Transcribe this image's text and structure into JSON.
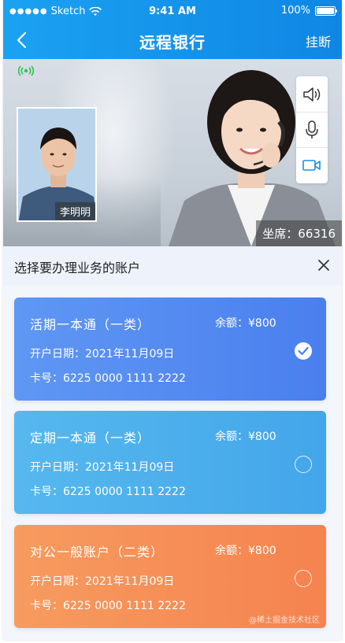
{
  "status_bar": {
    "carrier": "Sketch",
    "time": "9:41 AM",
    "battery": "100%"
  },
  "nav": {
    "title": "远程银行",
    "hangup_label": "挂断"
  },
  "video": {
    "caller_name": "李明明",
    "seat_label": "坐席：66316"
  },
  "account_panel": {
    "title": "选择要办理业务的账户"
  },
  "accounts": [
    {
      "name": "活期一本通（一类）",
      "balance": "余额：¥800",
      "open_date": "开户日期：2021年11月09日",
      "card_no": "卡号：6225 0000 1111 2222",
      "selected": true
    },
    {
      "name": "定期一本通（一类）",
      "balance": "余额：¥800",
      "open_date": "开户日期：2021年11月09日",
      "card_no": "卡号：6225 0000 1111 2222",
      "selected": false
    },
    {
      "name": "对公一般账户（二类）",
      "balance": "余额：¥800",
      "open_date": "开户日期：2021年11月09日",
      "card_no": "卡号：6225 0000 1111 2222",
      "selected": false
    }
  ],
  "watermark": "@稀土掘金技术社区",
  "icons": {
    "back": "chevron-left-icon",
    "signal": "live-signal-icon",
    "speaker": "speaker-icon",
    "mic": "microphone-icon",
    "camera": "video-camera-icon",
    "close": "close-icon",
    "check": "check-icon"
  },
  "colors": {
    "header": "#1096e8",
    "card1": "#5589f1",
    "card2": "#4cafec",
    "card3": "#f68f57",
    "signal_green": "#2bc44a",
    "control_blue": "#1a8ee6"
  }
}
